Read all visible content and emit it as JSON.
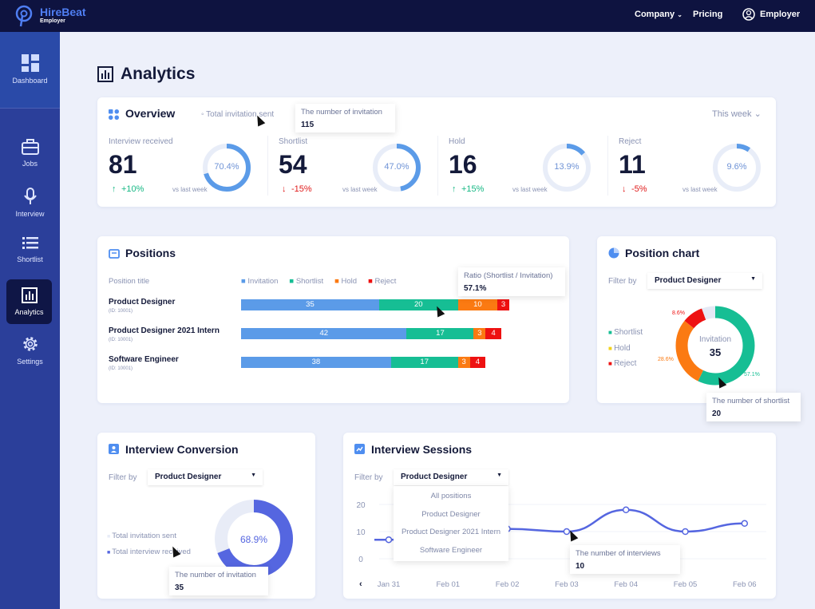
{
  "brand": {
    "name": "HireBeat",
    "sub": "Employer"
  },
  "nav": {
    "company": "Company",
    "pricing": "Pricing",
    "account": "Employer"
  },
  "sidebar": {
    "items": [
      {
        "label": "Dashboard",
        "icon": "dashboard-icon"
      },
      {
        "label": "Jobs",
        "icon": "briefcase-icon"
      },
      {
        "label": "Interview",
        "icon": "microphone-icon"
      },
      {
        "label": "Shortlist",
        "icon": "list-icon"
      },
      {
        "label": "Analytics",
        "icon": "analytics-icon",
        "active": true
      },
      {
        "label": "Settings",
        "icon": "gear-icon"
      }
    ]
  },
  "page": {
    "title": "Analytics"
  },
  "overview": {
    "title": "Overview",
    "legend": "Total invitation sent",
    "period": "This week",
    "tooltip": {
      "label": "The number of invitation",
      "value": "115"
    },
    "stats": [
      {
        "label": "Interview received",
        "value": "81",
        "change": "+10%",
        "dir": "up",
        "vs": "vs last week",
        "pct": 70.4,
        "pct_label": "70.4%"
      },
      {
        "label": "Shortlist",
        "value": "54",
        "change": "-15%",
        "dir": "down",
        "vs": "vs last week",
        "pct": 47.0,
        "pct_label": "47.0%"
      },
      {
        "label": "Hold",
        "value": "16",
        "change": "+15%",
        "dir": "up",
        "vs": "vs last week",
        "pct": 13.9,
        "pct_label": "13.9%"
      },
      {
        "label": "Reject",
        "value": "11",
        "change": "-5%",
        "dir": "down",
        "vs": "vs last week",
        "pct": 9.6,
        "pct_label": "9.6%"
      }
    ]
  },
  "positions": {
    "title": "Positions",
    "col": "Position title",
    "legend": [
      {
        "label": "Invitation",
        "color": "#5b9be8"
      },
      {
        "label": "Shortlist",
        "color": "#16be94"
      },
      {
        "label": "Hold",
        "color": "#fb7a12"
      },
      {
        "label": "Reject",
        "color": "#ee1111"
      }
    ],
    "tooltip": {
      "label": "Ratio (Shortlist / Invitation)",
      "value": "57.1%"
    },
    "rows": [
      {
        "name": "Product Designer",
        "id": "(ID: 10001)",
        "values": [
          35,
          20,
          10,
          3
        ]
      },
      {
        "name": "Product Designer 2021 Intern",
        "id": "(ID: 10001)",
        "values": [
          42,
          17,
          3,
          4
        ]
      },
      {
        "name": "Software Engineer",
        "id": "(ID: 10001)",
        "values": [
          38,
          17,
          3,
          4
        ]
      }
    ]
  },
  "position_chart": {
    "title": "Position chart",
    "filter_label": "Filter by",
    "filter": "Product Designer",
    "legend": [
      {
        "label": "Shortlist",
        "color": "#16be94"
      },
      {
        "label": "Hold",
        "color": "#f2d21b"
      },
      {
        "label": "Reject",
        "color": "#ee1111"
      }
    ],
    "center_label": "Invitation",
    "center_value": "35",
    "slices": [
      {
        "pct": 57.1,
        "label": "57.1%",
        "color": "#16be94"
      },
      {
        "pct": 28.6,
        "label": "28.6%",
        "color": "#fb7a12"
      },
      {
        "pct": 8.6,
        "label": "8.6%",
        "color": "#ee1111"
      },
      {
        "pct": 5.7,
        "color": "#e4e9f5"
      }
    ],
    "tooltip": {
      "label": "The number of shortlist",
      "value": "20"
    }
  },
  "conversion": {
    "title": "Interview Conversion",
    "filter_label": "Filter by",
    "filter": "Product Designer",
    "legend": [
      {
        "label": "Total invitation sent",
        "color": "#e8ecf7"
      },
      {
        "label": "Total interview received",
        "color": "#5566e0"
      }
    ],
    "pct": 68.9,
    "pct_label": "68.9%",
    "tooltip": {
      "label": "The number of invitation",
      "value": "35"
    }
  },
  "sessions": {
    "title": "Interview Sessions",
    "filter_label": "Filter by",
    "filter": "Product Designer",
    "dropdown": [
      "All positions",
      "Product Designer",
      "Product Designer 2021 Intern",
      "Software Engineer"
    ],
    "tooltip": {
      "label": "The number of interviews",
      "value": "10"
    }
  },
  "chart_data": {
    "type": "line",
    "x": [
      "Jan 31",
      "Feb 01",
      "Feb 02",
      "Feb 03",
      "Feb 04",
      "Feb 05",
      "Feb 06"
    ],
    "series": [
      {
        "values": [
          7,
          null,
          11,
          10,
          18,
          10,
          13
        ]
      }
    ],
    "yticks": [
      "20",
      "10",
      "0"
    ],
    "ylim": [
      0,
      20
    ],
    "color": "#5566e0"
  }
}
